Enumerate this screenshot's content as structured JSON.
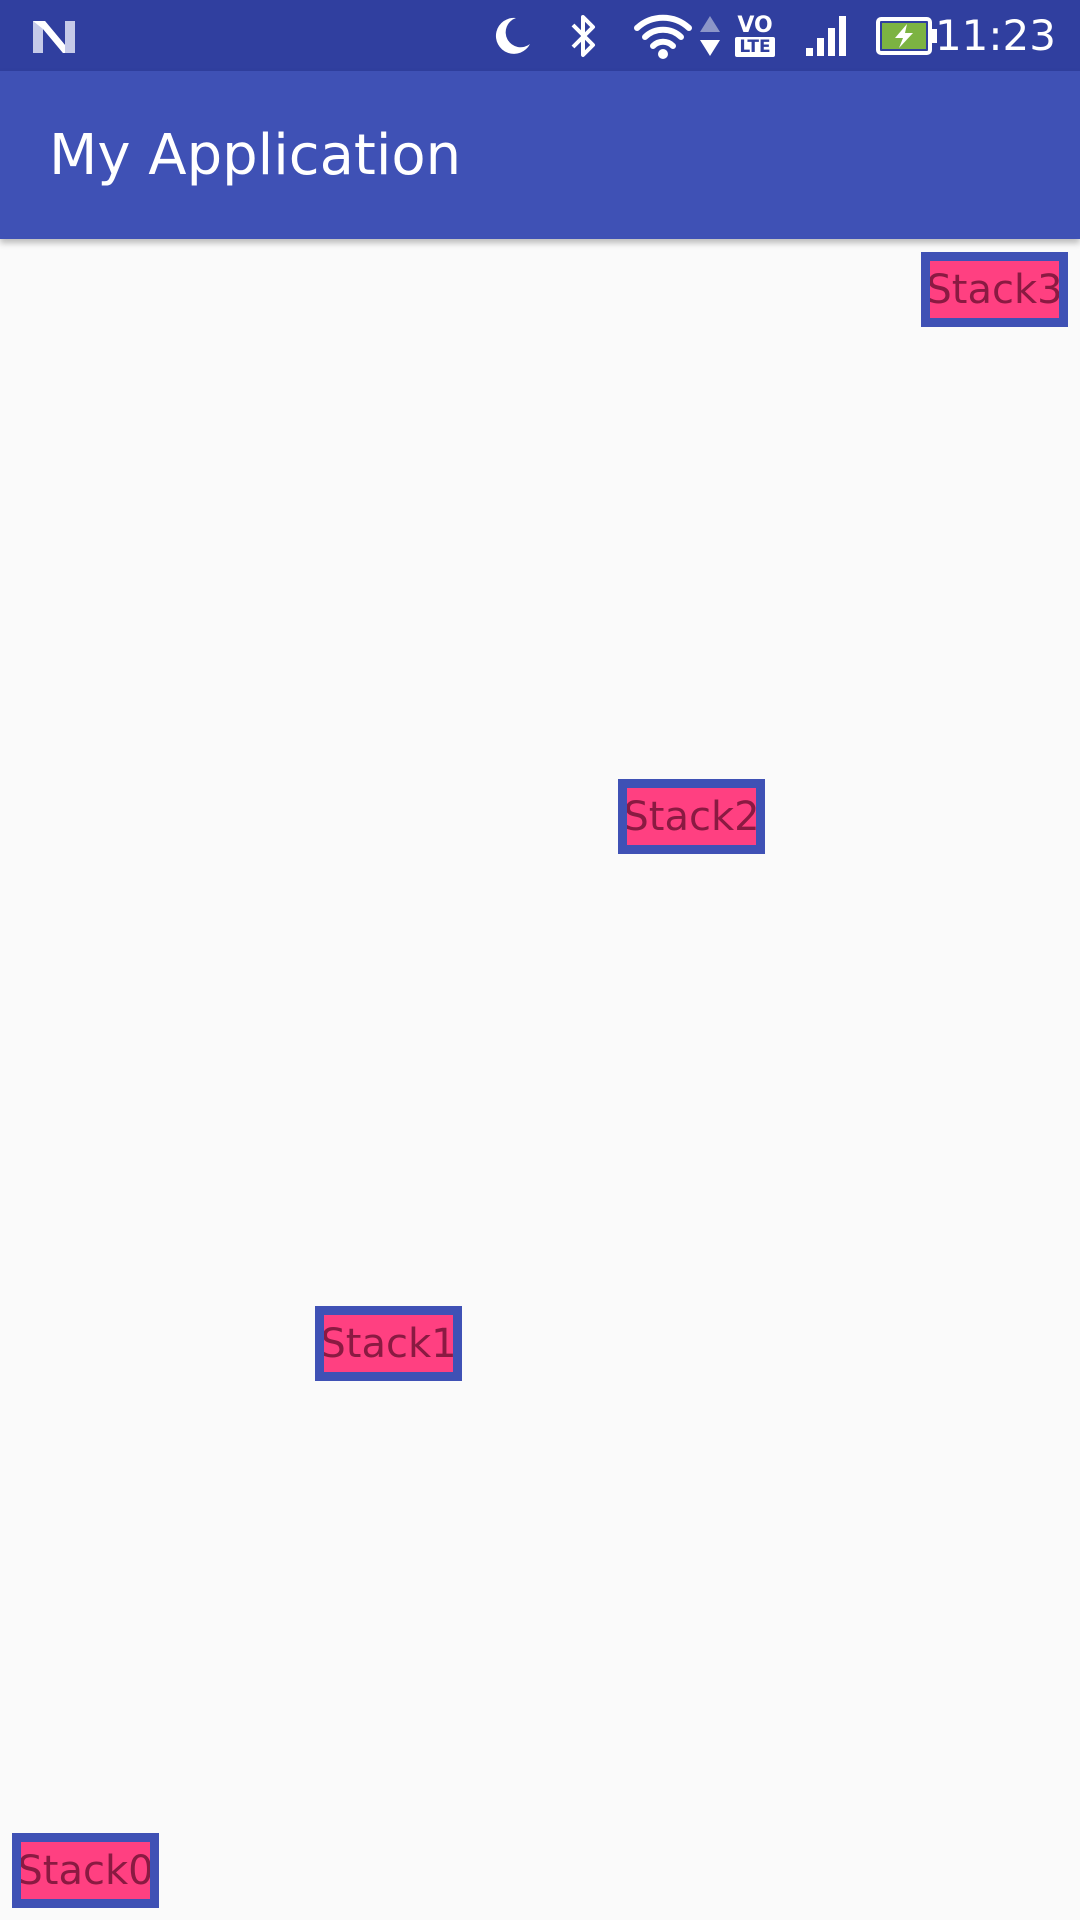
{
  "status_bar": {
    "time": "11:23",
    "volte_label_top": "VO",
    "volte_label_bottom": "LTE",
    "icons": {
      "notification": "n-logo-icon",
      "do_not_disturb": "moon-icon",
      "bluetooth": "bluetooth-icon",
      "wifi": "wifi-icon",
      "data_activity": "data-arrows-icon",
      "volte": "volte-icon",
      "signal": "signal-icon",
      "battery": "battery-charging-icon"
    }
  },
  "app_bar": {
    "title": "My Application"
  },
  "stacks": [
    {
      "label": "Stack0"
    },
    {
      "label": "Stack1"
    },
    {
      "label": "Stack2"
    },
    {
      "label": "Stack3"
    }
  ],
  "colors": {
    "status_bar": "#303f9f",
    "app_bar": "#3f51b5",
    "background": "#fafafa",
    "chip_fill": "#ff4081",
    "chip_border": "#3f51b5",
    "chip_text": "#8a1a42",
    "battery_fill": "#7cb342"
  }
}
